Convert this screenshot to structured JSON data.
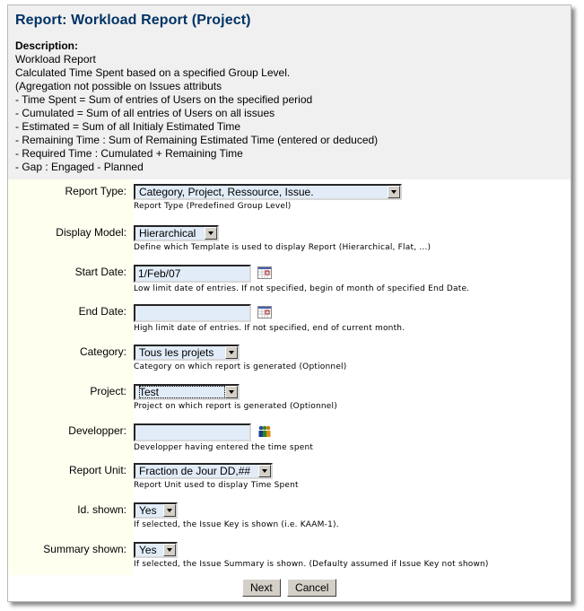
{
  "title": "Report: Workload Report (Project)",
  "description": {
    "label": "Description:",
    "lines": [
      "Workload Report",
      "Calculated Time Spent based on a specified Group Level.",
      "(Agregation not possible on Issues attributs",
      "- Time Spent = Sum of entries of Users on the specified period",
      "- Cumulated = Sum of all entries of Users on all issues",
      "- Estimated = Sum of all Initialy Estimated Time",
      "- Remaining Time : Sum of Remaining Estimated Time (entered or deduced)",
      "- Required Time : Cumulated + Remaining Time",
      "- Gap : Engaged - Planned"
    ]
  },
  "fields": {
    "report_type": {
      "label": "Report Type:",
      "value": "Category, Project, Ressource, Issue.",
      "hint": "Report Type (Predefined Group Level)"
    },
    "display_model": {
      "label": "Display Model:",
      "value": "Hierarchical",
      "hint": "Define which Template is used to display Report (Hierarchical, Flat, ...)"
    },
    "start_date": {
      "label": "Start Date:",
      "value": "1/Feb/07",
      "hint": "Low limit date of entries. If not specified, begin of month of specified End Date.",
      "icon": "calendar-icon"
    },
    "end_date": {
      "label": "End Date:",
      "value": "",
      "hint": "High limit date of entries. If not specified, end of current month.",
      "icon": "calendar-icon"
    },
    "category": {
      "label": "Category:",
      "value": "Tous les projets",
      "hint": "Category on which report is generated (Optionnel)"
    },
    "project": {
      "label": "Project:",
      "value": "Test",
      "hint": "Project on which report is generated (Optionnel)"
    },
    "developper": {
      "label": "Developper:",
      "value": "",
      "hint": "Developper having entered the time spent",
      "icon": "user-picker-icon"
    },
    "report_unit": {
      "label": "Report Unit:",
      "value": "Fraction de Jour DD,##",
      "hint": "Report Unit used to display Time Spent"
    },
    "id_shown": {
      "label": "Id. shown:",
      "value": "Yes",
      "hint": "If selected, the Issue Key is shown (i.e. KAAM-1)."
    },
    "summary_shown": {
      "label": "Summary shown:",
      "value": "Yes",
      "hint": "If selected, the Issue Summary is shown. (Defaulty assumed if Issue Key not shown)"
    }
  },
  "buttons": {
    "next": "Next",
    "cancel": "Cancel"
  }
}
